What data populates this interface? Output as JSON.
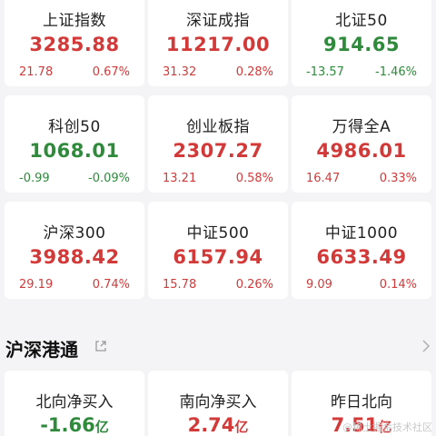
{
  "indices": [
    {
      "name": "上证指数",
      "price": "3285.88",
      "change": "21.78",
      "pct": "0.67%",
      "trend": "up"
    },
    {
      "name": "深证成指",
      "price": "11217.00",
      "change": "31.32",
      "pct": "0.28%",
      "trend": "up"
    },
    {
      "name": "北证50",
      "price": "914.65",
      "change": "-13.57",
      "pct": "-1.46%",
      "trend": "down"
    },
    {
      "name": "科创50",
      "price": "1068.01",
      "change": "-0.99",
      "pct": "-0.09%",
      "trend": "down"
    },
    {
      "name": "创业板指",
      "price": "2307.27",
      "change": "13.21",
      "pct": "0.58%",
      "trend": "up"
    },
    {
      "name": "万得全A",
      "price": "4986.01",
      "change": "16.47",
      "pct": "0.33%",
      "trend": "up"
    },
    {
      "name": "沪深300",
      "price": "3988.42",
      "change": "29.19",
      "pct": "0.74%",
      "trend": "up"
    },
    {
      "name": "中证500",
      "price": "6157.94",
      "change": "15.78",
      "pct": "0.26%",
      "trend": "up"
    },
    {
      "name": "中证1000",
      "price": "6633.49",
      "change": "9.09",
      "pct": "0.14%",
      "trend": "up"
    }
  ],
  "section": {
    "title": "沪深港通",
    "share_icon": "share-icon",
    "more_icon": "chevron-right-icon"
  },
  "flows": [
    {
      "name": "北向净买入",
      "value": "-1.66",
      "unit": "亿",
      "trend": "down"
    },
    {
      "name": "南向净买入",
      "value": "2.74",
      "unit": "亿",
      "trend": "up"
    },
    {
      "name": "昨日北向",
      "value": "7.51",
      "unit": "亿",
      "trend": "up"
    }
  ],
  "watermark": "@稀土掘金技术社区",
  "colors": {
    "up": "#d23a3a",
    "down": "#2f8a3c",
    "background": "#f4f4f6",
    "card": "#ffffff"
  }
}
